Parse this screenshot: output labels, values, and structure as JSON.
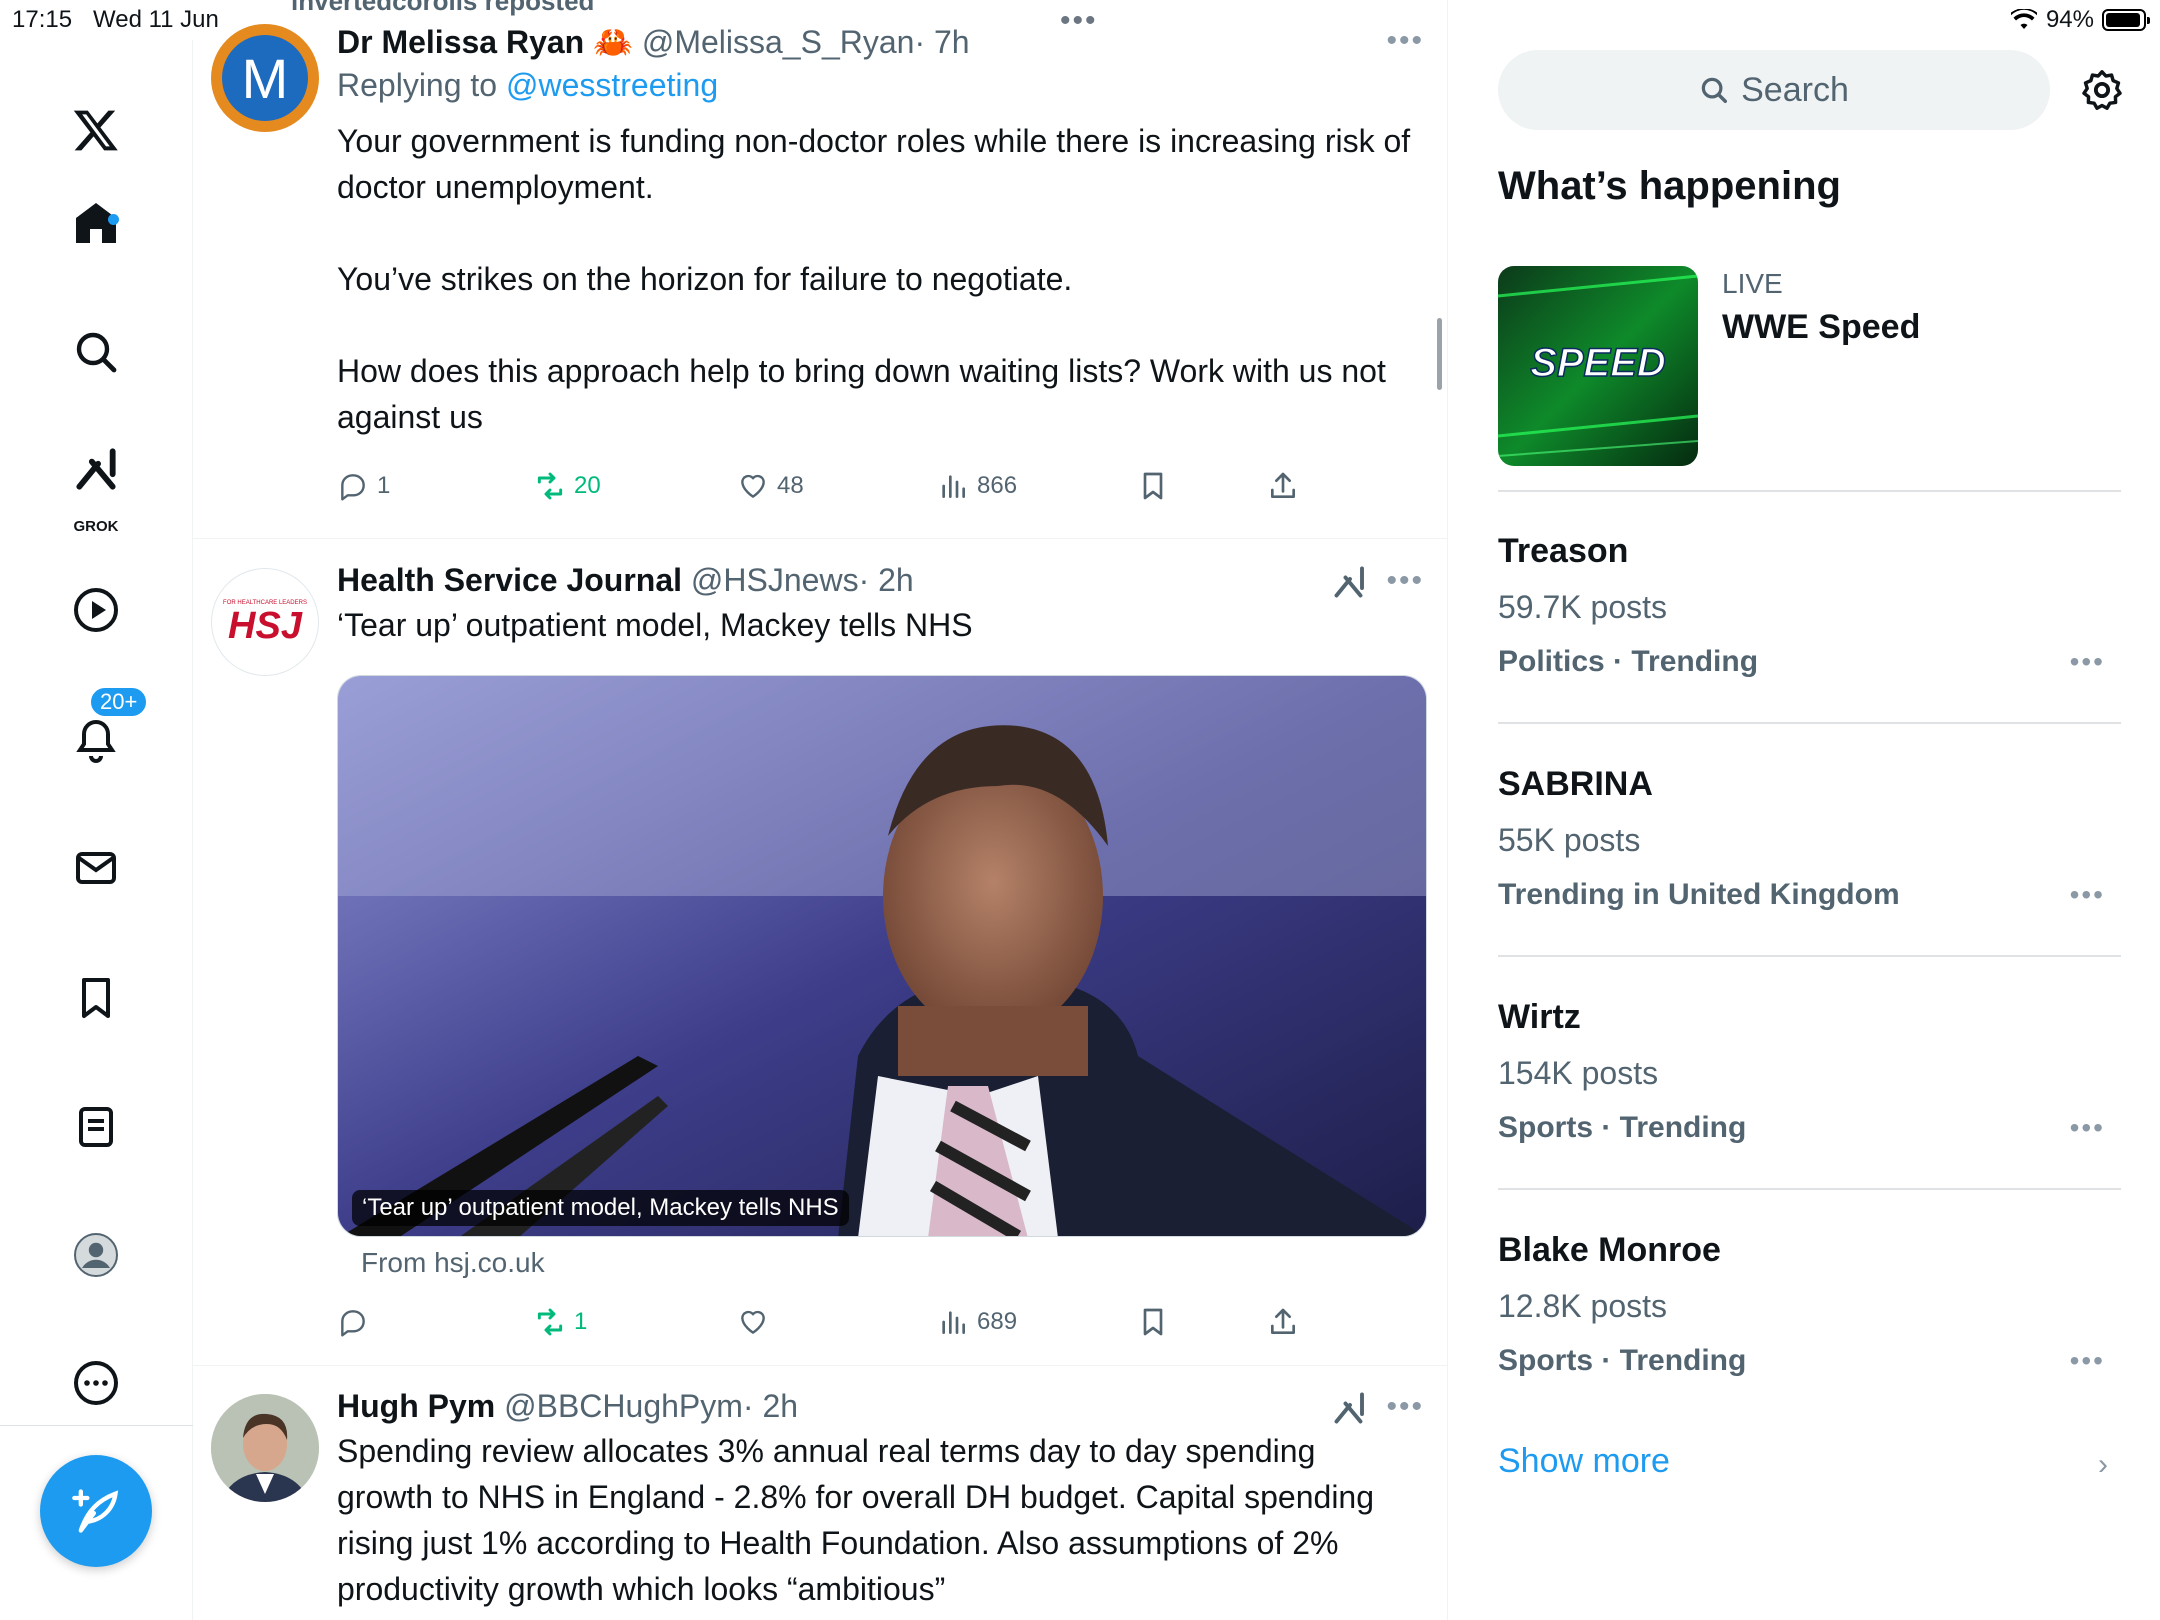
{
  "status_bar": {
    "time": "17:15",
    "date": "Wed 11 Jun",
    "battery": "94%"
  },
  "nav": {
    "grok_label": "GROK",
    "notifications_badge": "20+"
  },
  "feed": {
    "repost_banner": "invertedcorolis reposted",
    "tweets": [
      {
        "name": "Dr Melissa Ryan 🦀",
        "handle": "@Melissa_S_Ryan",
        "time": "· 7h",
        "replying_prefix": "Replying to ",
        "replying_to": "@wesstreeting",
        "text_1": "Your government is funding non-doctor roles while there is increasing risk of doctor unemployment.",
        "text_2": "You’ve strikes on the horizon for failure to negotiate.",
        "text_3": "How does this approach help to bring down waiting lists? Work with us not against us",
        "replies": "1",
        "reposts": "20",
        "likes": "48",
        "views": "866",
        "avatar_letter": "M"
      },
      {
        "name": "Health Service Journal",
        "handle": "@HSJnews",
        "time": "· 2h",
        "text": "‘Tear up’ outpatient model, Mackey tells NHS",
        "card_caption": "‘Tear up’ outpatient model, Mackey tells NHS",
        "card_from": "From hsj.co.uk",
        "replies": "",
        "reposts": "1",
        "likes": "",
        "views": "689",
        "avatar_text": "HSJ",
        "avatar_small": "FOR HEALTHCARE LEADERS"
      },
      {
        "name": "Hugh Pym",
        "handle": "@BBCHughPym",
        "time": "· 2h",
        "text": "Spending review allocates 3% annual real terms day to day spending growth to NHS in England - 2.8% for overall DH budget. Capital spending rising just 1% according to Health Foundation. Also assumptions of 2% productivity growth which looks “ambitious”"
      }
    ]
  },
  "sidebar": {
    "search_placeholder": "Search",
    "heading": "What’s happening",
    "live": {
      "label": "LIVE",
      "title": "WWE Speed",
      "image_text": "SPEED"
    },
    "trends": [
      {
        "name": "Treason",
        "posts": "59.7K posts",
        "category": "Politics · Trending"
      },
      {
        "name": "SABRINA",
        "posts": "55K posts",
        "category": "Trending in United Kingdom"
      },
      {
        "name": "Wirtz",
        "posts": "154K posts",
        "category": "Sports · Trending"
      },
      {
        "name": "Blake Monroe",
        "posts": "12.8K posts",
        "category": "Sports · Trending"
      }
    ],
    "show_more": "Show more"
  }
}
